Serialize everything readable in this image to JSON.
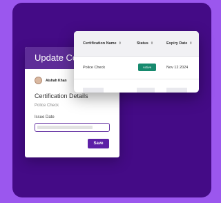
{
  "modal": {
    "title": "Update Certification",
    "user_name": "Aishah Khan",
    "section_title": "Certification Details",
    "section_subtitle": "Police Check",
    "field_label": "Issue Date",
    "save_label": "Save"
  },
  "table": {
    "columns": [
      "Certification Name",
      "Status",
      "Expiry Date"
    ],
    "rows": [
      {
        "name": "Police Check",
        "status": "Active",
        "expiry": "Nov 12 2024"
      }
    ]
  },
  "colors": {
    "background": "#9b57ee",
    "panel": "#440b86",
    "modal_header": "#5e2d98",
    "primary_button": "#5d20a6",
    "status_active": "#178a6e"
  },
  "icons": [
    "sort-icon",
    "avatar"
  ]
}
